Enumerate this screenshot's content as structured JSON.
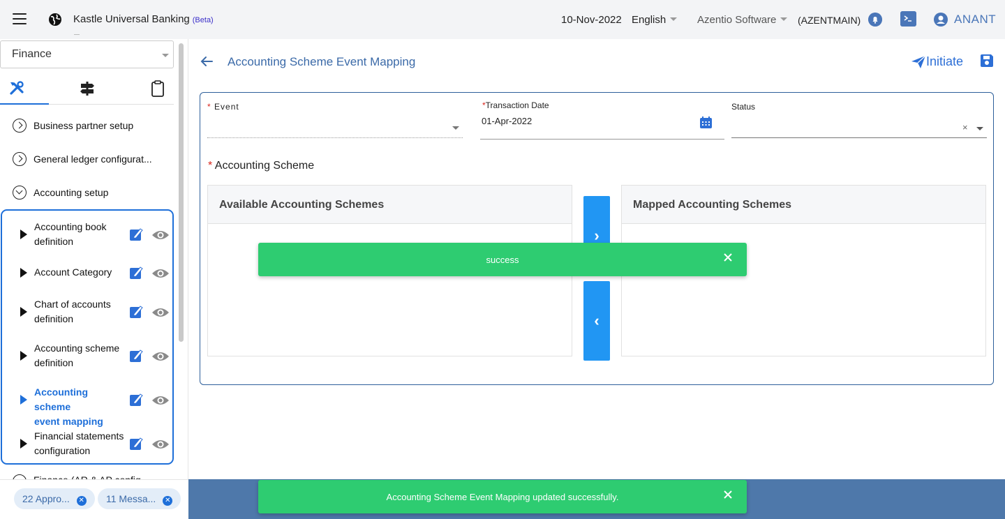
{
  "header": {
    "app_title": "Kastle Universal Banking",
    "beta": "(Beta)",
    "date": "10-Nov-2022",
    "language": "English",
    "company": "Azentio Software",
    "entity_code": "(AZENTMAIN)",
    "user": "ANANT"
  },
  "sidebar": {
    "module": "Finance",
    "items": [
      {
        "label": "Business partner setup"
      },
      {
        "label": "General ledger configurat..."
      },
      {
        "label": "Accounting setup"
      }
    ],
    "sub_items": [
      {
        "line1": "Accounting book",
        "line2": "definition"
      },
      {
        "line1": "Account Category",
        "line2": ""
      },
      {
        "line1": "Chart of accounts",
        "line2": "definition"
      },
      {
        "line1": "Accounting scheme",
        "line2": "definition"
      },
      {
        "line1": "Accounting scheme",
        "line2": "event mapping"
      },
      {
        "line1": "Financial statements",
        "line2": "configuration"
      }
    ],
    "partial_item": "Finance (AR & AP config",
    "chips": [
      {
        "label": "22 Appro..."
      },
      {
        "label": "11 Messa..."
      }
    ]
  },
  "main": {
    "title": "Accounting Scheme Event Mapping",
    "initiate_label": "Initiate",
    "form": {
      "event_label": "Event",
      "transaction_date_label": "Transaction Date",
      "transaction_date_value": "01-Apr-2022",
      "status_label": "Status",
      "status_clear": "×",
      "accounting_scheme_label": "Accounting Scheme",
      "required_mark": "*",
      "available_header": "Available Accounting Schemes",
      "mapped_header": "Mapped Accounting Schemes",
      "move_right": "›",
      "move_left": "‹"
    }
  },
  "toasts": [
    {
      "message": "success"
    },
    {
      "message": "Accounting Scheme Event Mapping updated successfully."
    }
  ],
  "colors": {
    "accent": "#1e6fd9",
    "toast_green": "#2ecc71",
    "move_button": "#2196f3",
    "footer_band": "#4e78aa"
  }
}
